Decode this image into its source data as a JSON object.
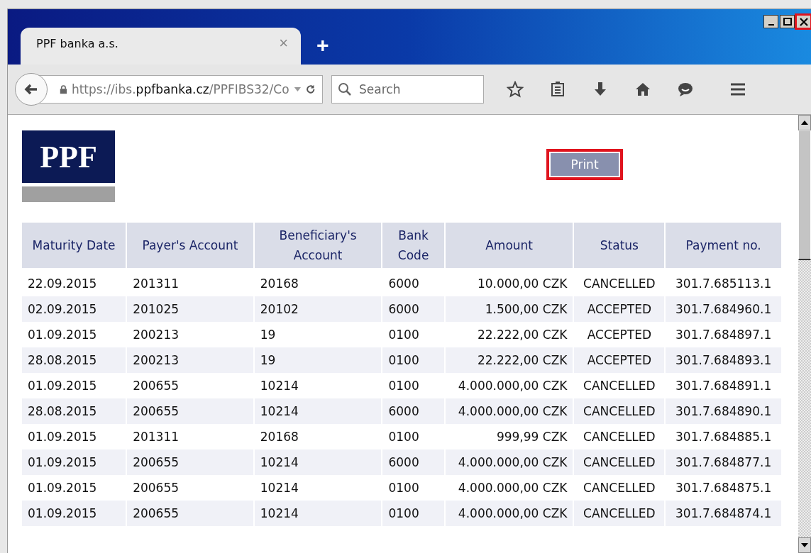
{
  "window": {
    "controls": [
      {
        "kind": "minimize",
        "highlighted": false
      },
      {
        "kind": "maximize",
        "highlighted": false
      },
      {
        "kind": "close",
        "highlighted": true
      }
    ]
  },
  "tabs": [
    {
      "label": "PPF banka a.s.",
      "selected": true,
      "close": "×"
    }
  ],
  "new_tab": "+",
  "toolbar": {
    "url": {
      "prefix": "https://ibs.",
      "domain": "ppfbanka.cz",
      "path": "/PPFIBS32/Co"
    },
    "search": {
      "placeholder": "Search"
    }
  },
  "page": {
    "logo": "PPF",
    "print_button": {
      "label": "Print",
      "highlighted": true
    },
    "table": {
      "columns": [
        {
          "label": "Maturity Date"
        },
        {
          "label": "Payer's Account"
        },
        {
          "label": "Beneficiary's Account"
        },
        {
          "label": "Bank Code"
        },
        {
          "label": "Amount"
        },
        {
          "label": "Status"
        },
        {
          "label": "Payment no."
        }
      ],
      "rows": [
        [
          "22.09.2015",
          "201311",
          "20168",
          "6000",
          "10.000,00 CZK",
          "CANCELLED",
          "301.7.685113.1"
        ],
        [
          "02.09.2015",
          "201025",
          "20102",
          "6000",
          "1.500,00 CZK",
          "ACCEPTED",
          "301.7.684960.1"
        ],
        [
          "01.09.2015",
          "200213",
          "19",
          "0100",
          "22.222,00 CZK",
          "ACCEPTED",
          "301.7.684897.1"
        ],
        [
          "28.08.2015",
          "200213",
          "19",
          "0100",
          "22.222,00 CZK",
          "ACCEPTED",
          "301.7.684893.1"
        ],
        [
          "01.09.2015",
          "200655",
          "10214",
          "0100",
          "4.000.000,00 CZK",
          "CANCELLED",
          "301.7.684891.1"
        ],
        [
          "28.08.2015",
          "200655",
          "10214",
          "6000",
          "4.000.000,00 CZK",
          "CANCELLED",
          "301.7.684890.1"
        ],
        [
          "01.09.2015",
          "201311",
          "20168",
          "0100",
          "999,99 CZK",
          "CANCELLED",
          "301.7.684885.1"
        ],
        [
          "01.09.2015",
          "200655",
          "10214",
          "6000",
          "4.000.000,00 CZK",
          "CANCELLED",
          "301.7.684877.1"
        ],
        [
          "01.09.2015",
          "200655",
          "10214",
          "0100",
          "4.000.000,00 CZK",
          "CANCELLED",
          "301.7.684875.1"
        ],
        [
          "01.09.2015",
          "200655",
          "10214",
          "0100",
          "4.000.000,00 CZK",
          "CANCELLED",
          "301.7.684874.1"
        ]
      ]
    }
  }
}
